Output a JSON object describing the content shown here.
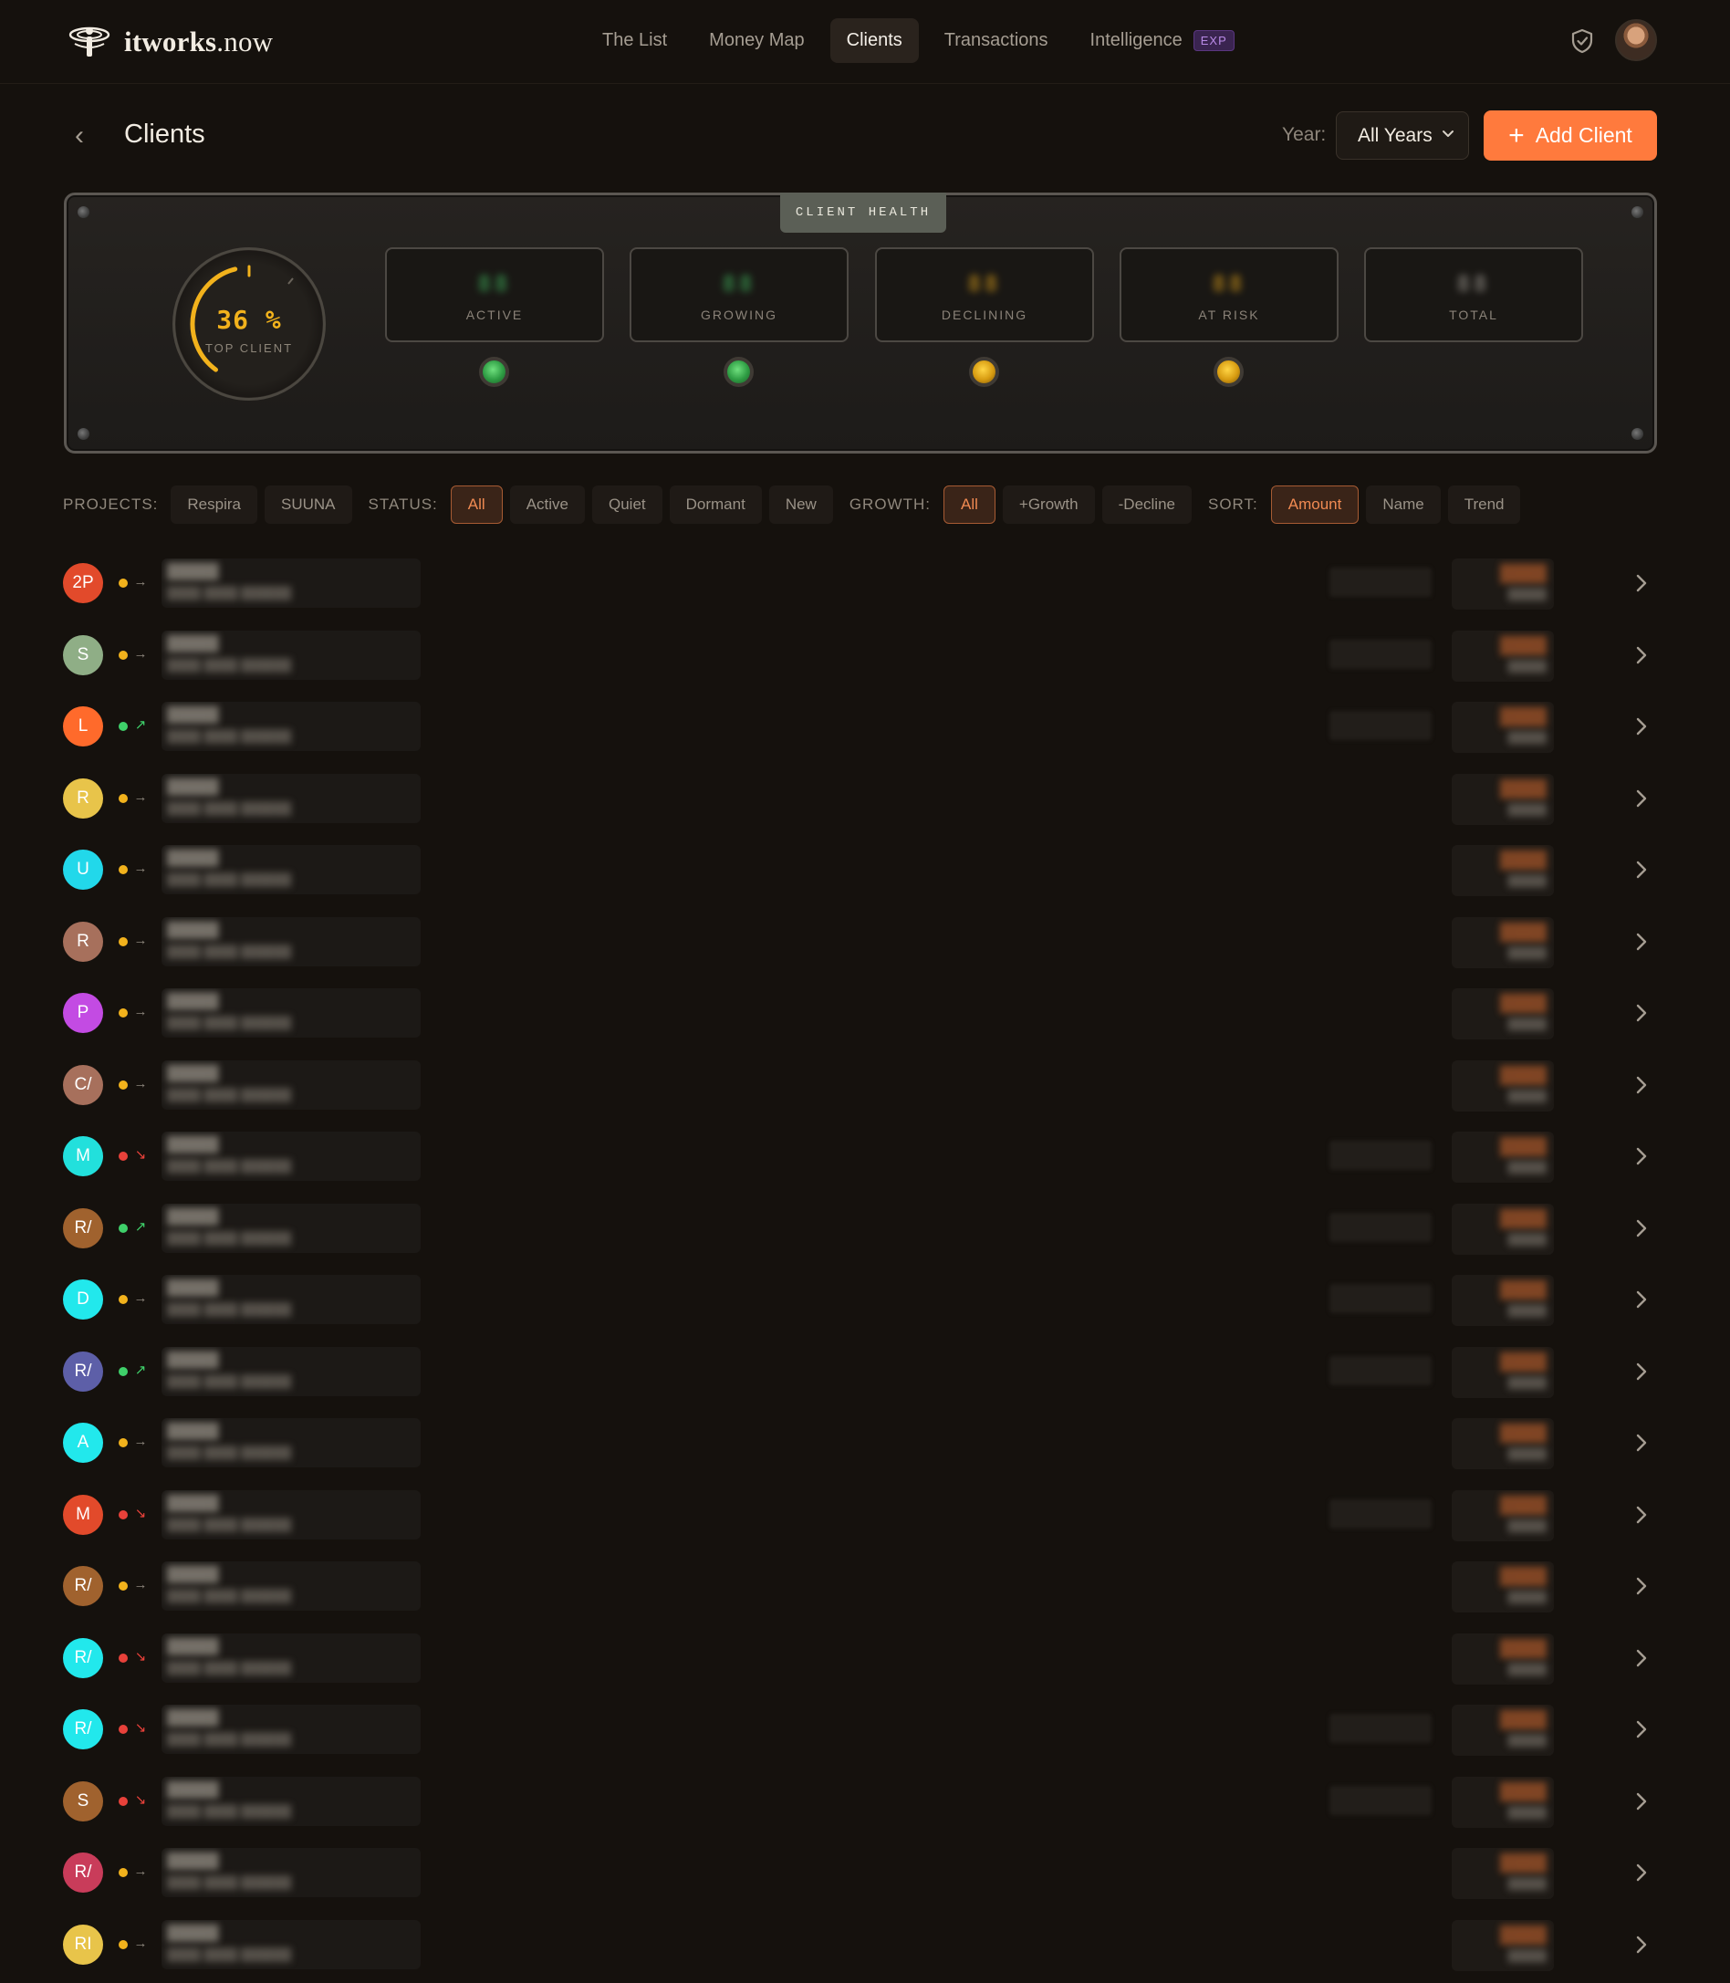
{
  "brand": {
    "name_bold": "itworks",
    "name_rest": ".now"
  },
  "nav": {
    "items": [
      {
        "label": "The List"
      },
      {
        "label": "Money Map"
      },
      {
        "label": "Clients",
        "active": true
      },
      {
        "label": "Transactions"
      },
      {
        "label": "Intelligence",
        "badge": "EXP"
      }
    ]
  },
  "header": {
    "title": "Clients",
    "year_label": "Year:",
    "year_value": "All Years",
    "add_label": "Add Client"
  },
  "health": {
    "tab_label": "CLIENT HEALTH",
    "gauge_value": "36 %",
    "gauge_label": "TOP CLIENT",
    "gauge_percent": 36,
    "meters": [
      {
        "label": "ACTIVE",
        "digits": "88",
        "color": "#3fae5a",
        "led": "green"
      },
      {
        "label": "GROWING",
        "digits": "88",
        "color": "#3fae5a",
        "led": "green"
      },
      {
        "label": "DECLINING",
        "digits": "88",
        "color": "#d59a1a",
        "led": "amber"
      },
      {
        "label": "AT RISK",
        "digits": "88",
        "color": "#d59a1a",
        "led": "amber"
      },
      {
        "label": "TOTAL",
        "digits": "88",
        "color": "#9a958e",
        "led": null
      }
    ]
  },
  "filters": {
    "projects_label": "PROJECTS:",
    "projects": [
      "Respira",
      "SUUNA"
    ],
    "status_label": "STATUS:",
    "status": [
      "All",
      "Active",
      "Quiet",
      "Dormant",
      "New"
    ],
    "status_selected": "All",
    "growth_label": "GROWTH:",
    "growth": [
      "All",
      "+Growth",
      "-Decline"
    ],
    "growth_selected": "All",
    "sort_label": "SORT:",
    "sort": [
      "Amount",
      "Name",
      "Trend"
    ],
    "sort_selected": "Amount"
  },
  "clients": [
    {
      "initials": "2P",
      "color": "#e24a2b",
      "status": "quiet",
      "trend": "flat",
      "extra": true
    },
    {
      "initials": "S",
      "color": "#8fae86",
      "status": "quiet",
      "trend": "flat",
      "extra": true
    },
    {
      "initials": "L",
      "color": "#ff6a2b",
      "status": "active",
      "trend": "up",
      "extra": true
    },
    {
      "initials": "R",
      "color": "#e8c44a",
      "status": "quiet",
      "trend": "flat",
      "extra": false
    },
    {
      "initials": "U",
      "color": "#22d8ea",
      "status": "quiet",
      "trend": "flat",
      "extra": false
    },
    {
      "initials": "R",
      "color": "#a7705c",
      "status": "quiet",
      "trend": "flat",
      "extra": false
    },
    {
      "initials": "P",
      "color": "#c34be3",
      "status": "quiet",
      "trend": "flat",
      "extra": false
    },
    {
      "initials": "C/",
      "color": "#a7705c",
      "status": "quiet",
      "trend": "flat",
      "extra": false
    },
    {
      "initials": "M",
      "color": "#22e0dc",
      "status": "atrisk",
      "trend": "down",
      "extra": true
    },
    {
      "initials": "R/",
      "color": "#a0622e",
      "status": "active",
      "trend": "up",
      "extra": true
    },
    {
      "initials": "D",
      "color": "#22e8ec",
      "status": "quiet",
      "trend": "flat",
      "extra": true
    },
    {
      "initials": "R/",
      "color": "#5d5fa8",
      "status": "active",
      "trend": "up",
      "extra": true
    },
    {
      "initials": "A",
      "color": "#22e8ec",
      "status": "quiet",
      "trend": "flat",
      "extra": false
    },
    {
      "initials": "M",
      "color": "#e24a2b",
      "status": "atrisk",
      "trend": "down",
      "extra": true
    },
    {
      "initials": "R/",
      "color": "#a0622e",
      "status": "quiet",
      "trend": "flat",
      "extra": false
    },
    {
      "initials": "R/",
      "color": "#22e8ec",
      "status": "atrisk",
      "trend": "down",
      "extra": false
    },
    {
      "initials": "R/",
      "color": "#22e8ec",
      "status": "atrisk",
      "trend": "down",
      "extra": true
    },
    {
      "initials": "S",
      "color": "#a0622e",
      "status": "atrisk",
      "trend": "down",
      "extra": true
    },
    {
      "initials": "R/",
      "color": "#c93c5a",
      "status": "quiet",
      "trend": "flat",
      "extra": false
    },
    {
      "initials": "RI",
      "color": "#e8c44a",
      "status": "quiet",
      "trend": "flat",
      "extra": false
    }
  ],
  "colors": {
    "accent": "#ff7a3d",
    "status_active": "#3fd06a",
    "status_quiet": "#f2b21c",
    "status_atrisk": "#e8413a"
  }
}
